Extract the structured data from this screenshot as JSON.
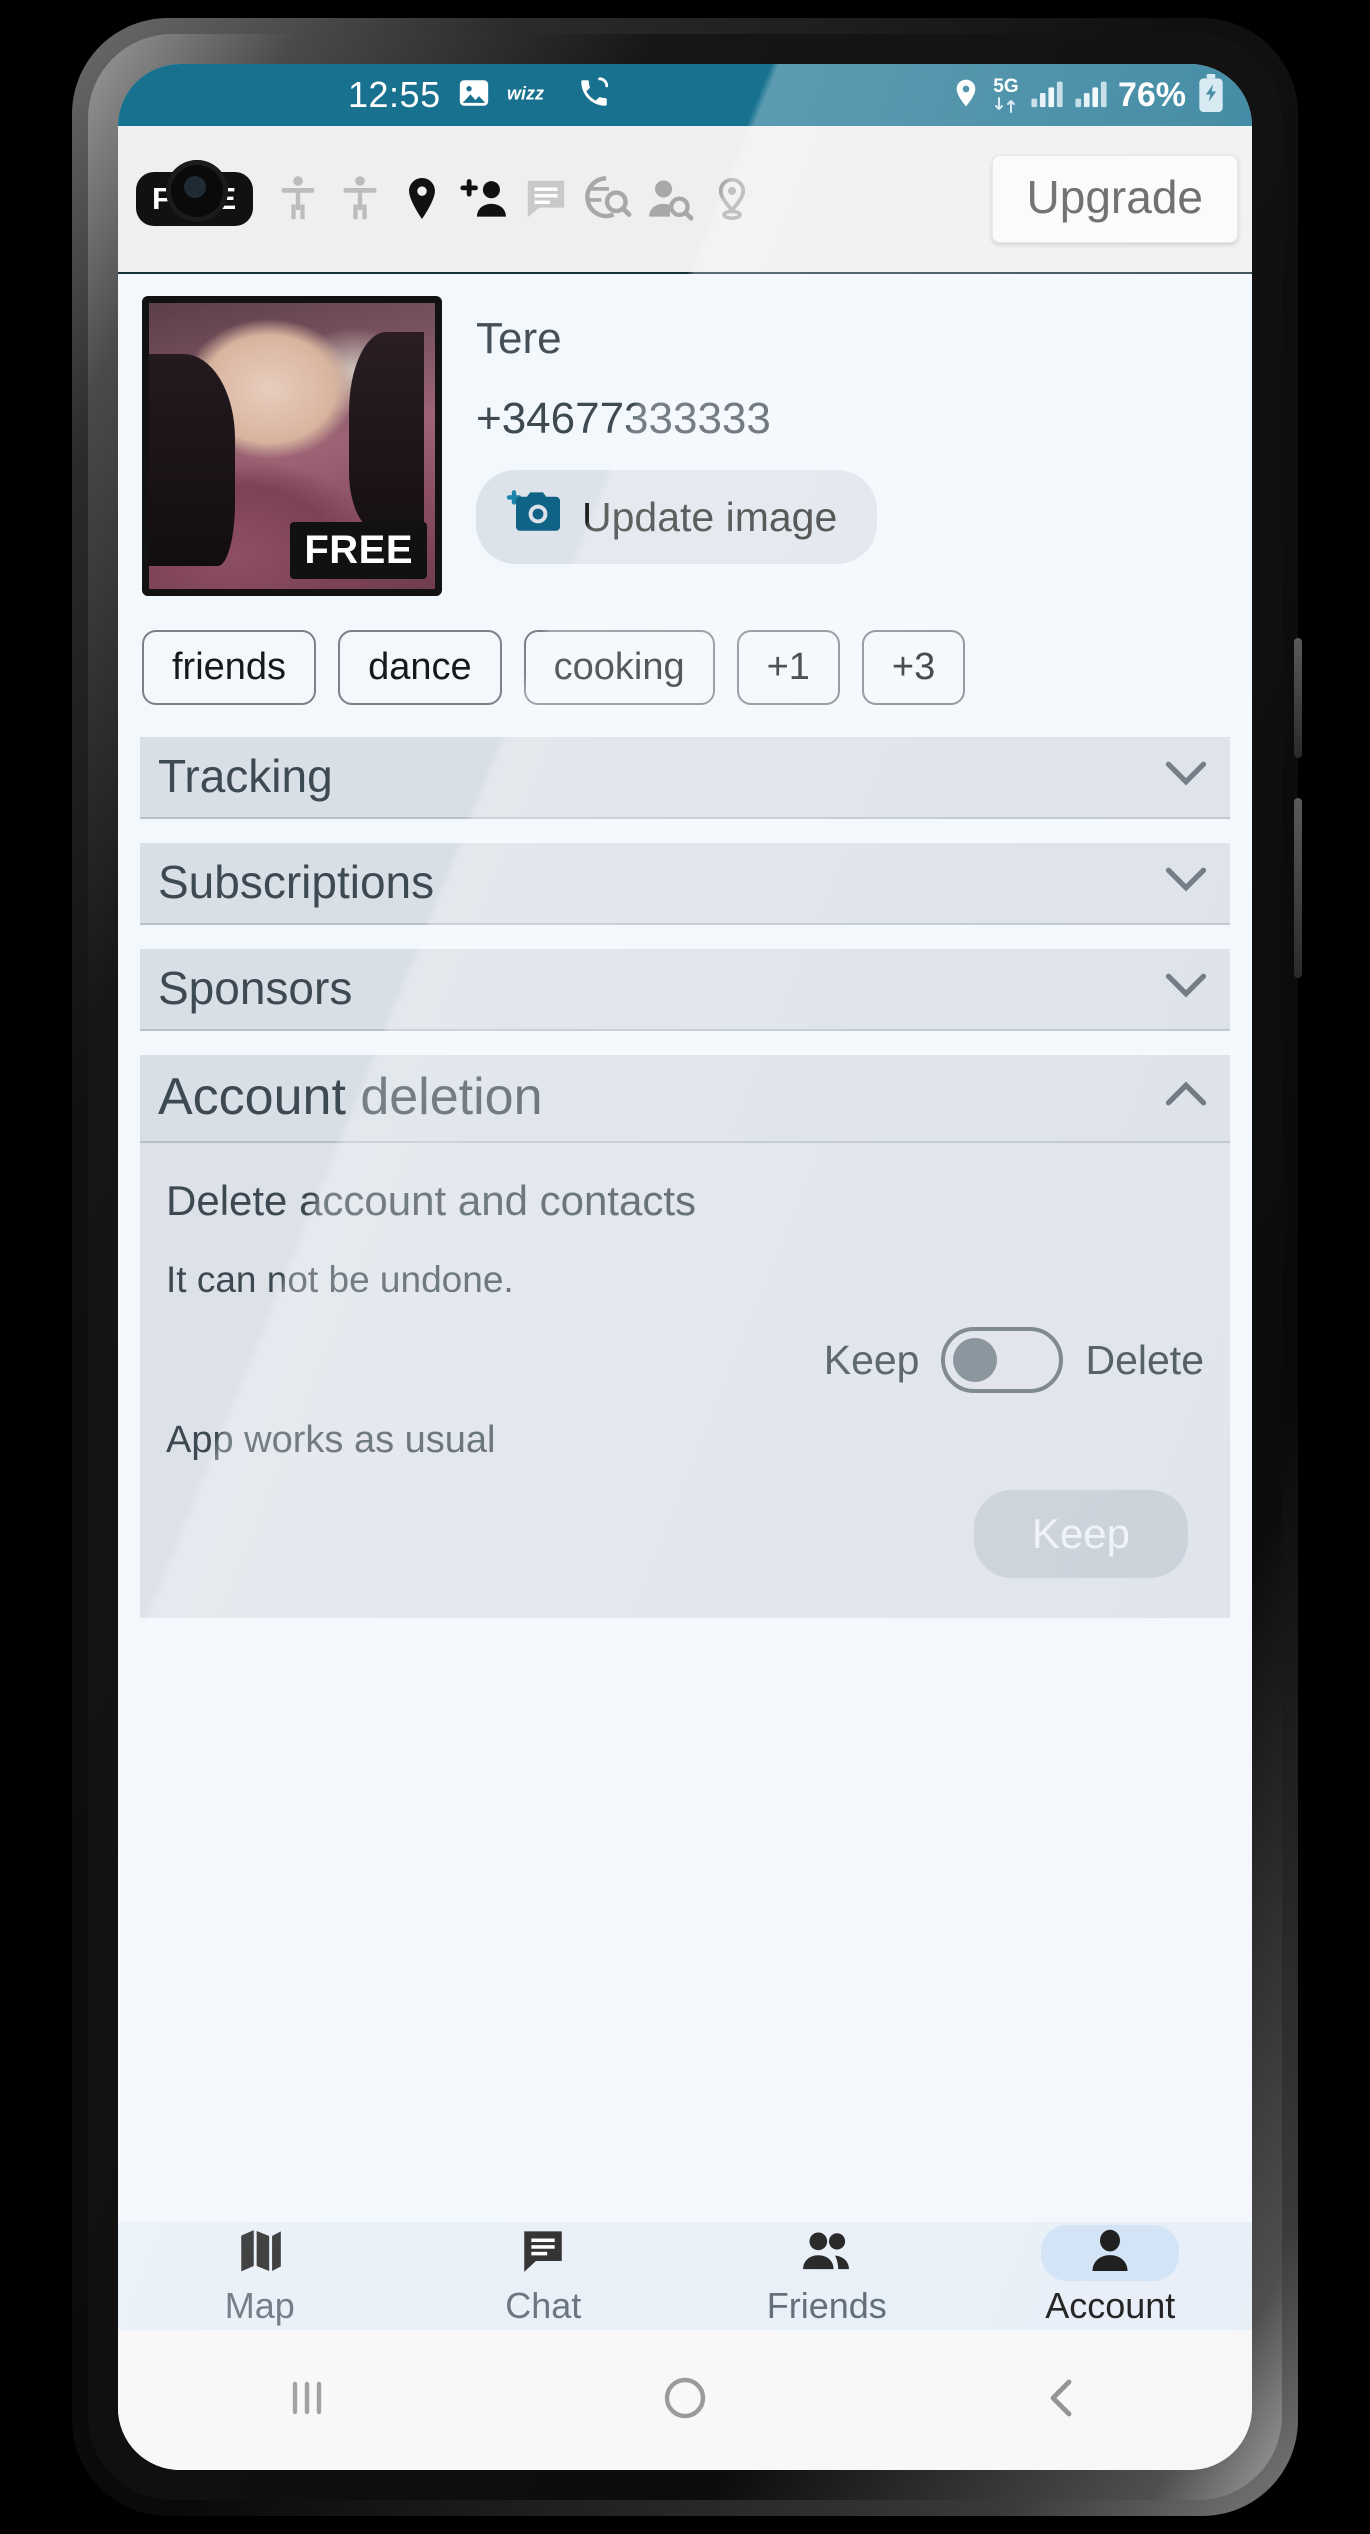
{
  "status_bar": {
    "time": "12:55",
    "icons_left": [
      "image-icon",
      "wizz-logo-icon",
      "phone-call-icon"
    ],
    "location_icon": "location-pin-icon",
    "network_type": "5G",
    "signal_icons": [
      "signal-bars-icon",
      "signal-bars-icon"
    ],
    "battery_percent": "76%",
    "battery_icon": "battery-charging-icon",
    "background_color": "#17718f"
  },
  "toolbar": {
    "free_badge": "FREE",
    "icons": [
      {
        "name": "person-standing-icon",
        "state": "muted"
      },
      {
        "name": "person-standing-icon",
        "state": "muted"
      },
      {
        "name": "location-pin-icon",
        "state": "active"
      },
      {
        "name": "add-person-icon",
        "state": "active"
      },
      {
        "name": "chat-bubble-icon",
        "state": "muted"
      },
      {
        "name": "globe-search-icon",
        "state": "muted"
      },
      {
        "name": "person-search-icon",
        "state": "muted"
      },
      {
        "name": "pin-outline-icon",
        "state": "muted"
      }
    ],
    "upgrade_label": "Upgrade"
  },
  "profile": {
    "name": "Tere",
    "phone": "+34677333333",
    "avatar_badge": "FREE",
    "update_image_label": "Update image",
    "camera_icon": "add-photo-camera-icon",
    "accent_color": "#0f6384"
  },
  "tags": [
    "friends",
    "dance",
    "cooking",
    "+1",
    "+3"
  ],
  "sections": [
    {
      "id": "tracking",
      "title": "Tracking",
      "expanded": false,
      "chevron": "chevron-down-icon"
    },
    {
      "id": "subscriptions",
      "title": "Subscriptions",
      "expanded": false,
      "chevron": "chevron-down-icon"
    },
    {
      "id": "sponsors",
      "title": "Sponsors",
      "expanded": false,
      "chevron": "chevron-down-icon"
    },
    {
      "id": "account_deletion",
      "title": "Account deletion",
      "expanded": true,
      "chevron": "chevron-up-icon"
    }
  ],
  "account_deletion": {
    "title": "Account deletion",
    "chevron": "chevron-up-icon",
    "heading": "Delete account and contacts",
    "warning": "It can not be undone.",
    "toggle_left_label": "Keep",
    "toggle_right_label": "Delete",
    "toggle_state": "Keep",
    "status_text": "App works as usual",
    "confirm_button_label": "Keep",
    "confirm_button_disabled": true
  },
  "bottom_nav": {
    "items": [
      {
        "label": "Map",
        "icon": "map-icon",
        "active": false
      },
      {
        "label": "Chat",
        "icon": "chat-bubble-icon",
        "active": false
      },
      {
        "label": "Friends",
        "icon": "people-icon",
        "active": false
      },
      {
        "label": "Account",
        "icon": "person-icon",
        "active": true
      }
    ],
    "active_pill_color": "#cfe2f6"
  },
  "android_nav": {
    "recents": "recents-button",
    "home": "home-button",
    "back": "back-button"
  }
}
